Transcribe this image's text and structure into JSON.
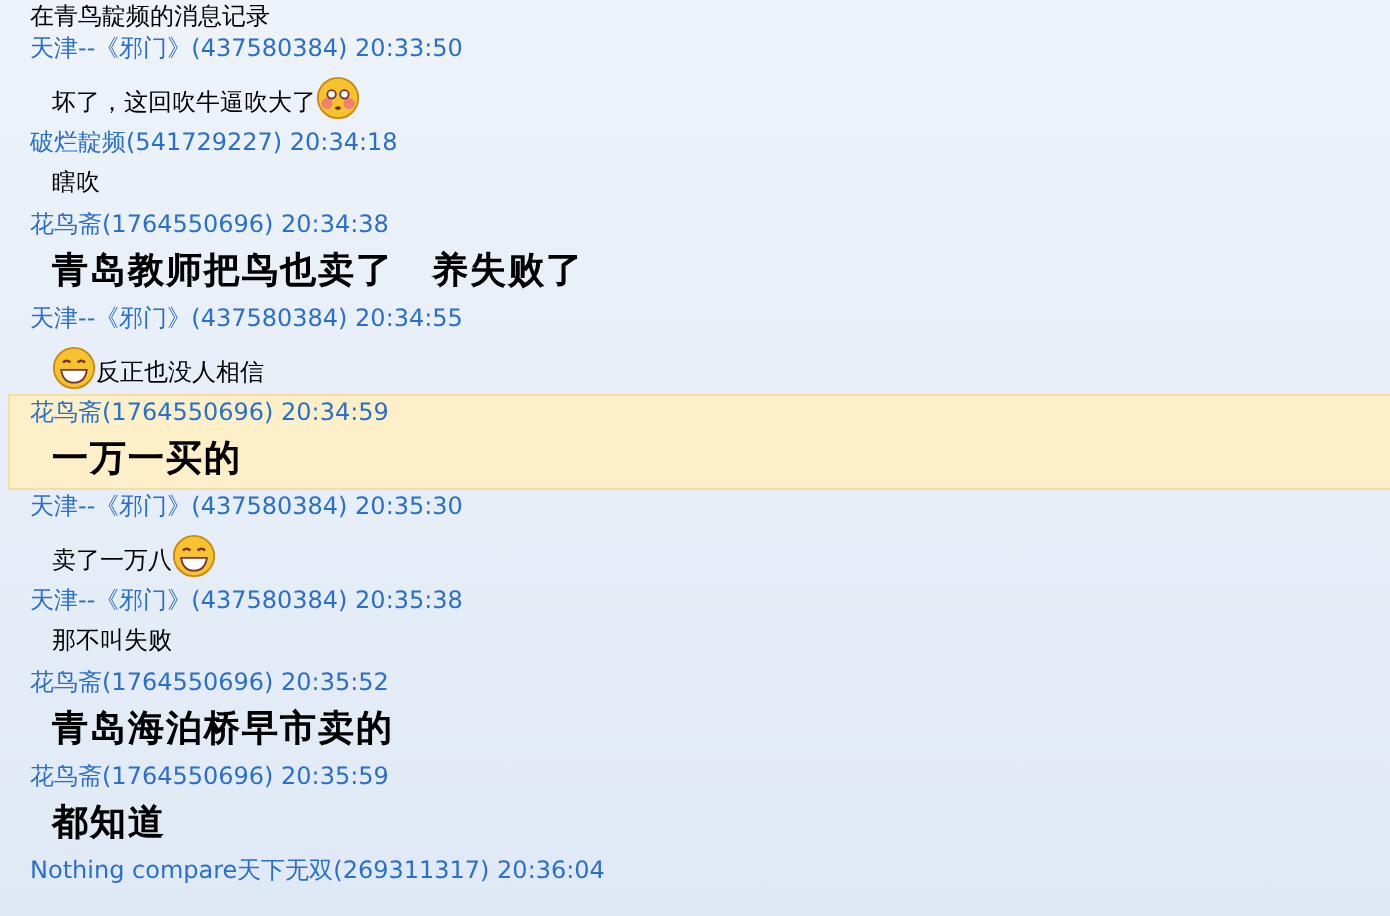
{
  "header": "在青鸟靛频的消息记录",
  "messages": [
    {
      "sender": "天津--《邪门》(437580384) 20:33:50",
      "kind": "plain",
      "parts": [
        {
          "kind": "text",
          "text": "坏了，这回吹牛逼吹大了"
        },
        {
          "kind": "blush"
        }
      ],
      "selected": false
    },
    {
      "sender": "破烂靛频(541729227) 20:34:18",
      "kind": "plain",
      "parts": [
        {
          "kind": "text",
          "text": "瞎吹"
        }
      ],
      "selected": false
    },
    {
      "sender": "花鸟斋(1764550696) 20:34:38",
      "kind": "bold",
      "parts": [
        {
          "kind": "text",
          "text": "青岛教师把鸟也卖了　养失败了"
        }
      ],
      "selected": false
    },
    {
      "sender": "天津--《邪门》(437580384) 20:34:55",
      "kind": "plain",
      "parts": [
        {
          "kind": "grin"
        },
        {
          "kind": "text",
          "text": "反正也没人相信"
        }
      ],
      "selected": false
    },
    {
      "sender": "花鸟斋(1764550696) 20:34:59",
      "kind": "bold",
      "parts": [
        {
          "kind": "text",
          "text": "一万一买的"
        }
      ],
      "selected": true
    },
    {
      "sender": "天津--《邪门》(437580384) 20:35:30",
      "kind": "plain",
      "parts": [
        {
          "kind": "text",
          "text": "卖了一万八"
        },
        {
          "kind": "grin"
        }
      ],
      "selected": false
    },
    {
      "sender": "天津--《邪门》(437580384) 20:35:38",
      "kind": "plain",
      "parts": [
        {
          "kind": "text",
          "text": "那不叫失败"
        }
      ],
      "selected": false
    },
    {
      "sender": "花鸟斋(1764550696) 20:35:52",
      "kind": "bold",
      "parts": [
        {
          "kind": "text",
          "text": "青岛海泊桥早市卖的"
        }
      ],
      "selected": false
    },
    {
      "sender": "花鸟斋(1764550696) 20:35:59",
      "kind": "bold",
      "parts": [
        {
          "kind": "text",
          "text": "都知道"
        }
      ],
      "selected": false
    },
    {
      "sender": "Nothing compare天下无双(269311317) 20:36:04",
      "selected": false
    }
  ]
}
